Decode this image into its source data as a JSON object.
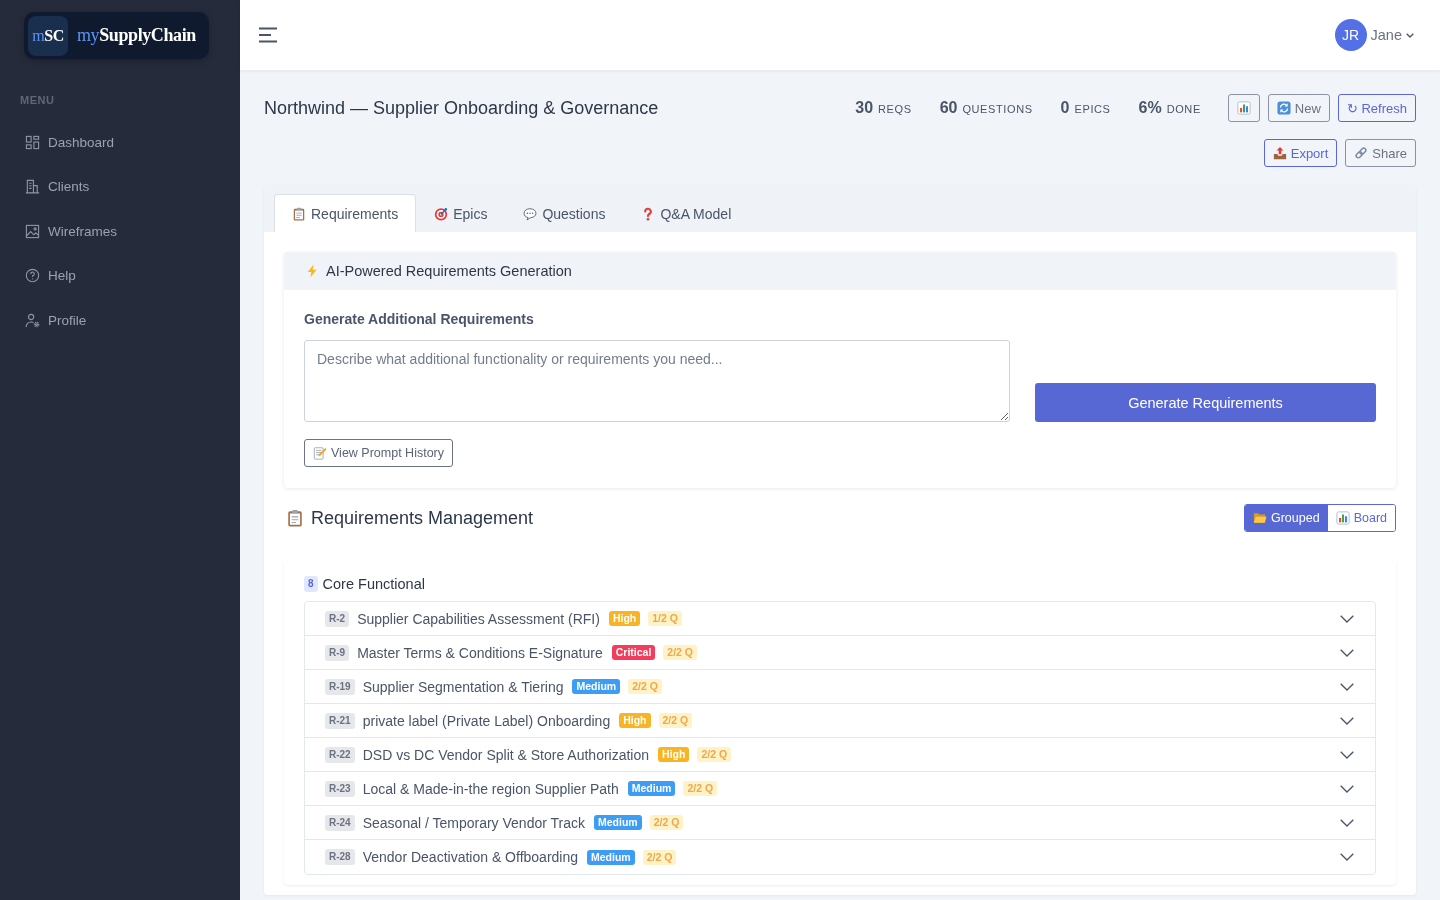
{
  "sidebar": {
    "logo": {
      "mark_accent": "m",
      "mark_rest": "SC",
      "name_accent": "my",
      "name_rest": "SupplyChain"
    },
    "section_label": "MENU",
    "items": [
      {
        "kind": "dashboard",
        "label": "Dashboard",
        "selected": false
      },
      {
        "kind": "clients",
        "label": "Clients",
        "selected": false
      },
      {
        "kind": "wireframes",
        "label": "Wireframes",
        "selected": false
      },
      {
        "kind": "help",
        "label": "Help",
        "selected": false
      },
      {
        "kind": "profile",
        "label": "Profile",
        "selected": false
      }
    ]
  },
  "topbar": {
    "user": {
      "initials": "JR",
      "name": "Jane"
    }
  },
  "project": {
    "title": "Northwind — Supplier Onboarding & Governance",
    "stats": [
      {
        "value": "30",
        "label": "REQS"
      },
      {
        "value": "60",
        "label": "QUESTIONS"
      },
      {
        "value": "0",
        "label": "EPICS"
      },
      {
        "value": "6%",
        "label": "DONE"
      }
    ],
    "action_rows": [
      [
        {
          "kind": "chart",
          "primary": false
        },
        {
          "kind": "new",
          "primary": false,
          "label": "New"
        },
        {
          "kind": "refresh",
          "primary": true,
          "label": "↻ Refresh"
        }
      ],
      [
        {
          "kind": "export",
          "primary": true,
          "label": "Export"
        },
        {
          "kind": "share",
          "primary": false,
          "label": "Share"
        }
      ]
    ]
  },
  "tabs": [
    {
      "kind": "clipboard",
      "label": "Requirements",
      "selected": true
    },
    {
      "kind": "target",
      "label": "Epics",
      "selected": false
    },
    {
      "kind": "speech",
      "label": "Questions",
      "selected": false
    },
    {
      "kind": "question",
      "label": "Q&A Model",
      "selected": false
    }
  ],
  "generator": {
    "title": "AI-Powered Requirements Generation",
    "field_label": "Generate Additional Requirements",
    "placeholder": "Describe what additional functionality or requirements you need...",
    "submit": "Generate Requirements",
    "history_button": "View Prompt History"
  },
  "management": {
    "title": "Requirements Management",
    "views": [
      {
        "kind": "folder",
        "label": "Grouped",
        "selected": true
      },
      {
        "kind": "chart",
        "label": "Board",
        "selected": false
      }
    ],
    "groups": [
      {
        "count": "8",
        "name": "Core Functional",
        "requirements": [
          {
            "id": "R-2",
            "title": "Supplier Capabilities Assessment (RFI)",
            "priority": "High",
            "color": "#f8b422",
            "questions": "1/2 Q",
            "expanded": false
          },
          {
            "id": "R-9",
            "title": "Master Terms & Conditions E-Signature",
            "priority": "Critical",
            "color": "#f33d5c",
            "questions": "2/2 Q",
            "expanded": false
          },
          {
            "id": "R-19",
            "title": "Supplier Segmentation & Tiering",
            "priority": "Medium",
            "color": "#3d9df5",
            "questions": "2/2 Q",
            "expanded": false
          },
          {
            "id": "R-21",
            "title": "private label (Private Label) Onboarding",
            "priority": "High",
            "color": "#f8b422",
            "questions": "2/2 Q",
            "expanded": false
          },
          {
            "id": "R-22",
            "title": "DSD vs DC Vendor Split & Store Authorization",
            "priority": "High",
            "color": "#f8b422",
            "questions": "2/2 Q",
            "expanded": false
          },
          {
            "id": "R-23",
            "title": "Local & Made-in-the region Supplier Path",
            "priority": "Medium",
            "color": "#3d9df5",
            "questions": "2/2 Q",
            "expanded": false
          },
          {
            "id": "R-24",
            "title": "Seasonal / Temporary Vendor Track",
            "priority": "Medium",
            "color": "#3d9df5",
            "questions": "2/2 Q",
            "expanded": false
          },
          {
            "id": "R-28",
            "title": "Vendor Deactivation & Offboarding",
            "priority": "Medium",
            "color": "#3d9df5",
            "questions": "2/2 Q",
            "expanded": false
          }
        ]
      }
    ]
  }
}
